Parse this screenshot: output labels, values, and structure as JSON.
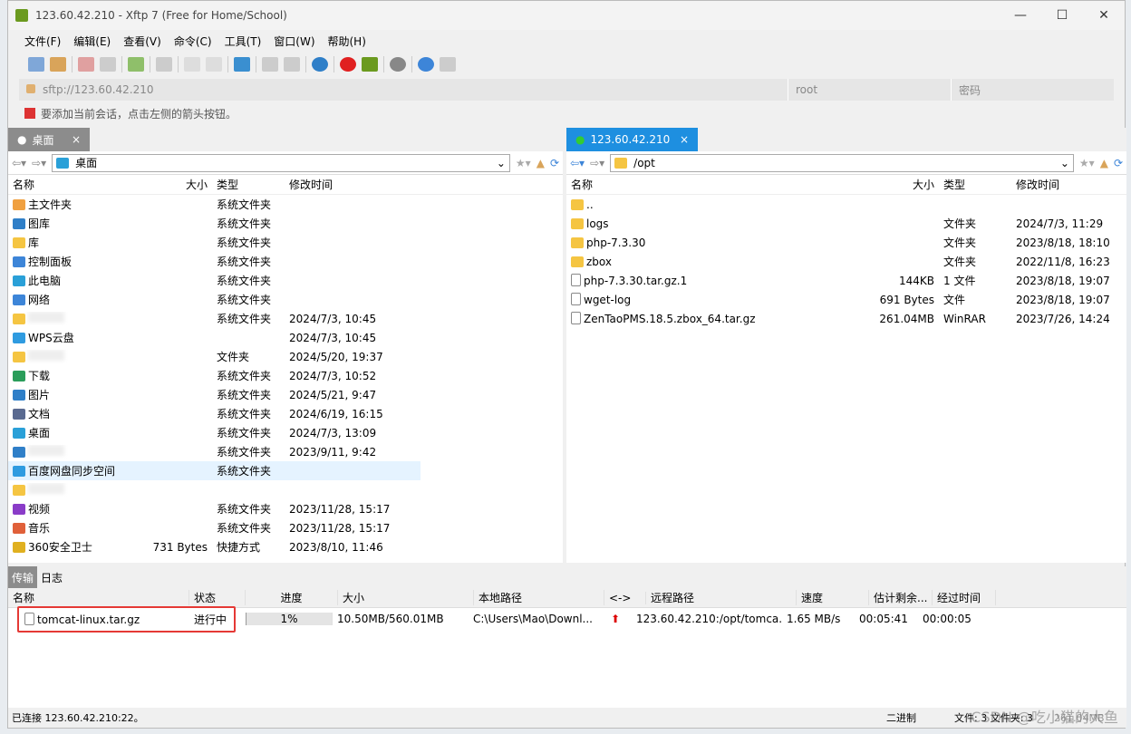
{
  "window": {
    "title": "123.60.42.210 - Xftp 7 (Free for Home/School)",
    "minimize": "—",
    "maximize": "☐",
    "close": "✕"
  },
  "menu": [
    "文件(F)",
    "编辑(E)",
    "查看(V)",
    "命令(C)",
    "工具(T)",
    "窗口(W)",
    "帮助(H)"
  ],
  "address": {
    "url": "sftp://123.60.42.210",
    "user_placeholder": "root",
    "password_placeholder": "密码"
  },
  "hint": "要添加当前会话，点击左侧的箭头按钮。",
  "left": {
    "tab": "桌面",
    "path": "桌面",
    "columns": [
      "名称",
      "大小",
      "类型",
      "修改时间"
    ],
    "rows": [
      {
        "name": "主文件夹",
        "size": "",
        "type": "系统文件夹",
        "date": ""
      },
      {
        "name": "图库",
        "size": "",
        "type": "系统文件夹",
        "date": ""
      },
      {
        "name": "库",
        "size": "",
        "type": "系统文件夹",
        "date": ""
      },
      {
        "name": "控制面板",
        "size": "",
        "type": "系统文件夹",
        "date": ""
      },
      {
        "name": "此电脑",
        "size": "",
        "type": "系统文件夹",
        "date": ""
      },
      {
        "name": "网络",
        "size": "",
        "type": "系统文件夹",
        "date": ""
      },
      {
        "name": "",
        "size": "",
        "type": "系统文件夹",
        "date": "2024/7/3, 10:45"
      },
      {
        "name": "WPS云盘",
        "size": "",
        "type": "",
        "date": "2024/7/3, 10:45"
      },
      {
        "name": "",
        "size": "",
        "type": "文件夹",
        "date": "2024/5/20, 19:37"
      },
      {
        "name": "下载",
        "size": "",
        "type": "系统文件夹",
        "date": "2024/7/3, 10:52"
      },
      {
        "name": "图片",
        "size": "",
        "type": "系统文件夹",
        "date": "2024/5/21, 9:47"
      },
      {
        "name": "文档",
        "size": "",
        "type": "系统文件夹",
        "date": "2024/6/19, 16:15"
      },
      {
        "name": "桌面",
        "size": "",
        "type": "系统文件夹",
        "date": "2024/7/3, 13:09"
      },
      {
        "name": "",
        "size": "",
        "type": "系统文件夹",
        "date": "2023/9/11, 9:42"
      },
      {
        "name": "百度网盘同步空间",
        "size": "",
        "type": "系统文件夹",
        "date": ""
      },
      {
        "name": "",
        "size": "",
        "type": "",
        "date": ""
      },
      {
        "name": "视频",
        "size": "",
        "type": "系统文件夹",
        "date": "2023/11/28, 15:17"
      },
      {
        "name": "音乐",
        "size": "",
        "type": "系统文件夹",
        "date": "2023/11/28, 15:17"
      },
      {
        "name": "360安全卫士",
        "size": "731 Bytes",
        "type": "快捷方式",
        "date": "2023/8/10, 11:46"
      }
    ]
  },
  "right": {
    "tab": "123.60.42.210",
    "path": "/opt",
    "columns": [
      "名称",
      "大小",
      "类型",
      "修改时间"
    ],
    "rows": [
      {
        "name": "..",
        "size": "",
        "type": "",
        "date": "",
        "icon": "folder"
      },
      {
        "name": "logs",
        "size": "",
        "type": "文件夹",
        "date": "2024/7/3, 11:29",
        "icon": "folder"
      },
      {
        "name": "php-7.3.30",
        "size": "",
        "type": "文件夹",
        "date": "2023/8/18, 18:10",
        "icon": "folder"
      },
      {
        "name": "zbox",
        "size": "",
        "type": "文件夹",
        "date": "2022/11/8, 16:23",
        "icon": "folder"
      },
      {
        "name": "php-7.3.30.tar.gz.1",
        "size": "144KB",
        "type": "1 文件",
        "date": "2023/8/18, 19:07",
        "icon": "file"
      },
      {
        "name": "wget-log",
        "size": "691 Bytes",
        "type": "文件",
        "date": "2023/8/18, 19:07",
        "icon": "file"
      },
      {
        "name": "ZenTaoPMS.18.5.zbox_64.tar.gz",
        "size": "261.04MB",
        "type": "WinRAR",
        "date": "2023/7/26, 14:24",
        "icon": "file"
      }
    ]
  },
  "transfer": {
    "tabs": [
      "传输",
      "日志"
    ],
    "columns": [
      "名称",
      "状态",
      "进度",
      "大小",
      "本地路径",
      "<->",
      "远程路径",
      "速度",
      "估计剩余...",
      "经过时间"
    ],
    "rows": [
      {
        "name": "tomcat-linux.tar.gz",
        "status": "进行中",
        "progress": "1%",
        "progress_value": 1,
        "size": "10.50MB/560.01MB",
        "local": "C:\\Users\\Mao\\Downl...",
        "direction": "up-arrow",
        "remote": "123.60.42.210:/opt/tomca...",
        "speed": "1.65 MB/s",
        "remaining": "00:05:41",
        "elapsed": "00:00:05"
      }
    ]
  },
  "status": {
    "connection": "已连接 123.60.42.210:22。",
    "mode": "二进制",
    "counts": "文件: 3 文件夹: 3",
    "size": "261.04MB"
  },
  "watermark": "CSDN @吃小猫的大鱼",
  "colors": {
    "active_tab": "#1e8fe0",
    "inactive_tab": "#8c8c8c",
    "highlight": "#e53935"
  }
}
